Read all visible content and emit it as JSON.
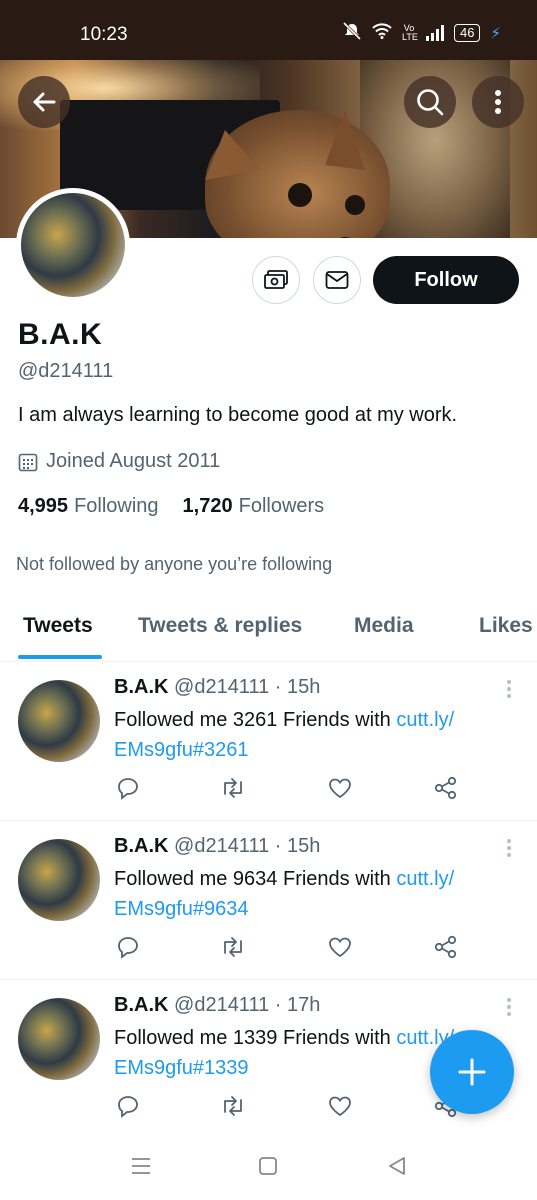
{
  "status_bar": {
    "time": "10:23",
    "network": "Vo LTE",
    "battery": "46"
  },
  "banner": {
    "back_icon": "arrow-left-icon",
    "search_icon": "search-icon",
    "more_icon": "more-vertical-icon"
  },
  "profile": {
    "name": "B.A.K",
    "handle": "@d214111",
    "bio": "I am always learning to become good at my work.",
    "joined": "Joined August 2011",
    "following_count": "4,995",
    "following_label": "Following",
    "followers_count": "1,720",
    "followers_label": "Followers",
    "not_followed": "Not followed by anyone you’re following",
    "follow_label": "Follow"
  },
  "tabs": [
    {
      "label": "Tweets",
      "active": true
    },
    {
      "label": "Tweets & replies",
      "active": false
    },
    {
      "label": "Media",
      "active": false
    },
    {
      "label": "Likes",
      "active": false
    }
  ],
  "tweets": [
    {
      "name": "B.A.K",
      "handle": "@d214111",
      "sep": "·",
      "time": "15h",
      "text": "Followed me 3261 Friends with ",
      "link1": "cutt.ly/",
      "link2": "EMs9gfu#3261"
    },
    {
      "name": "B.A.K",
      "handle": "@d214111",
      "sep": "·",
      "time": "15h",
      "text": "Followed me 9634 Friends with ",
      "link1": "cutt.ly/",
      "link2": "EMs9gfu#9634"
    },
    {
      "name": "B.A.K",
      "handle": "@d214111",
      "sep": "·",
      "time": "17h",
      "text": "Followed me 1339 Friends with ",
      "link1": "cutt.ly/",
      "link2": "EMs9gfu#1339"
    }
  ],
  "colors": {
    "accent": "#1d9bf0",
    "text_primary": "#0f1419",
    "text_secondary": "#536471"
  }
}
